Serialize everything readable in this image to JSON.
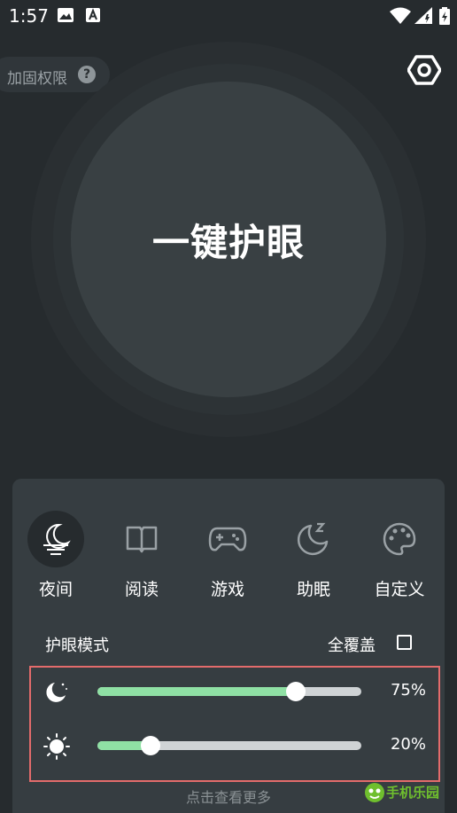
{
  "status_bar": {
    "time": "1:57",
    "icons": [
      "image-icon",
      "font-a-icon",
      "wifi-icon",
      "signal-icon",
      "battery-charging-icon"
    ]
  },
  "top": {
    "permission_label": "加固权限",
    "help_glyph": "?",
    "settings_icon": "hexagon-gear-icon"
  },
  "main_button": {
    "label": "一键护眼"
  },
  "modes": [
    {
      "label": "夜间",
      "icon": "night-moon-icon",
      "active": true
    },
    {
      "label": "阅读",
      "icon": "book-icon",
      "active": false
    },
    {
      "label": "游戏",
      "icon": "gamepad-icon",
      "active": false
    },
    {
      "label": "助眠",
      "icon": "sleep-moon-icon",
      "active": false
    },
    {
      "label": "自定义",
      "icon": "palette-icon",
      "active": false
    }
  ],
  "eye_mode": {
    "title": "护眼模式",
    "full_cover_label": "全覆盖",
    "full_cover_checked": false
  },
  "sliders": [
    {
      "icon": "moon-icon",
      "value": 75,
      "label": "75%"
    },
    {
      "icon": "sun-icon",
      "value": 20,
      "label": "20%"
    }
  ],
  "more_link": "点击查看更多",
  "watermark_text": "手机乐园",
  "colors": {
    "background": "#262b2e",
    "panel": "#363d41",
    "accent_green": "#8fe0a4",
    "highlight_red": "#e36b6b"
  }
}
